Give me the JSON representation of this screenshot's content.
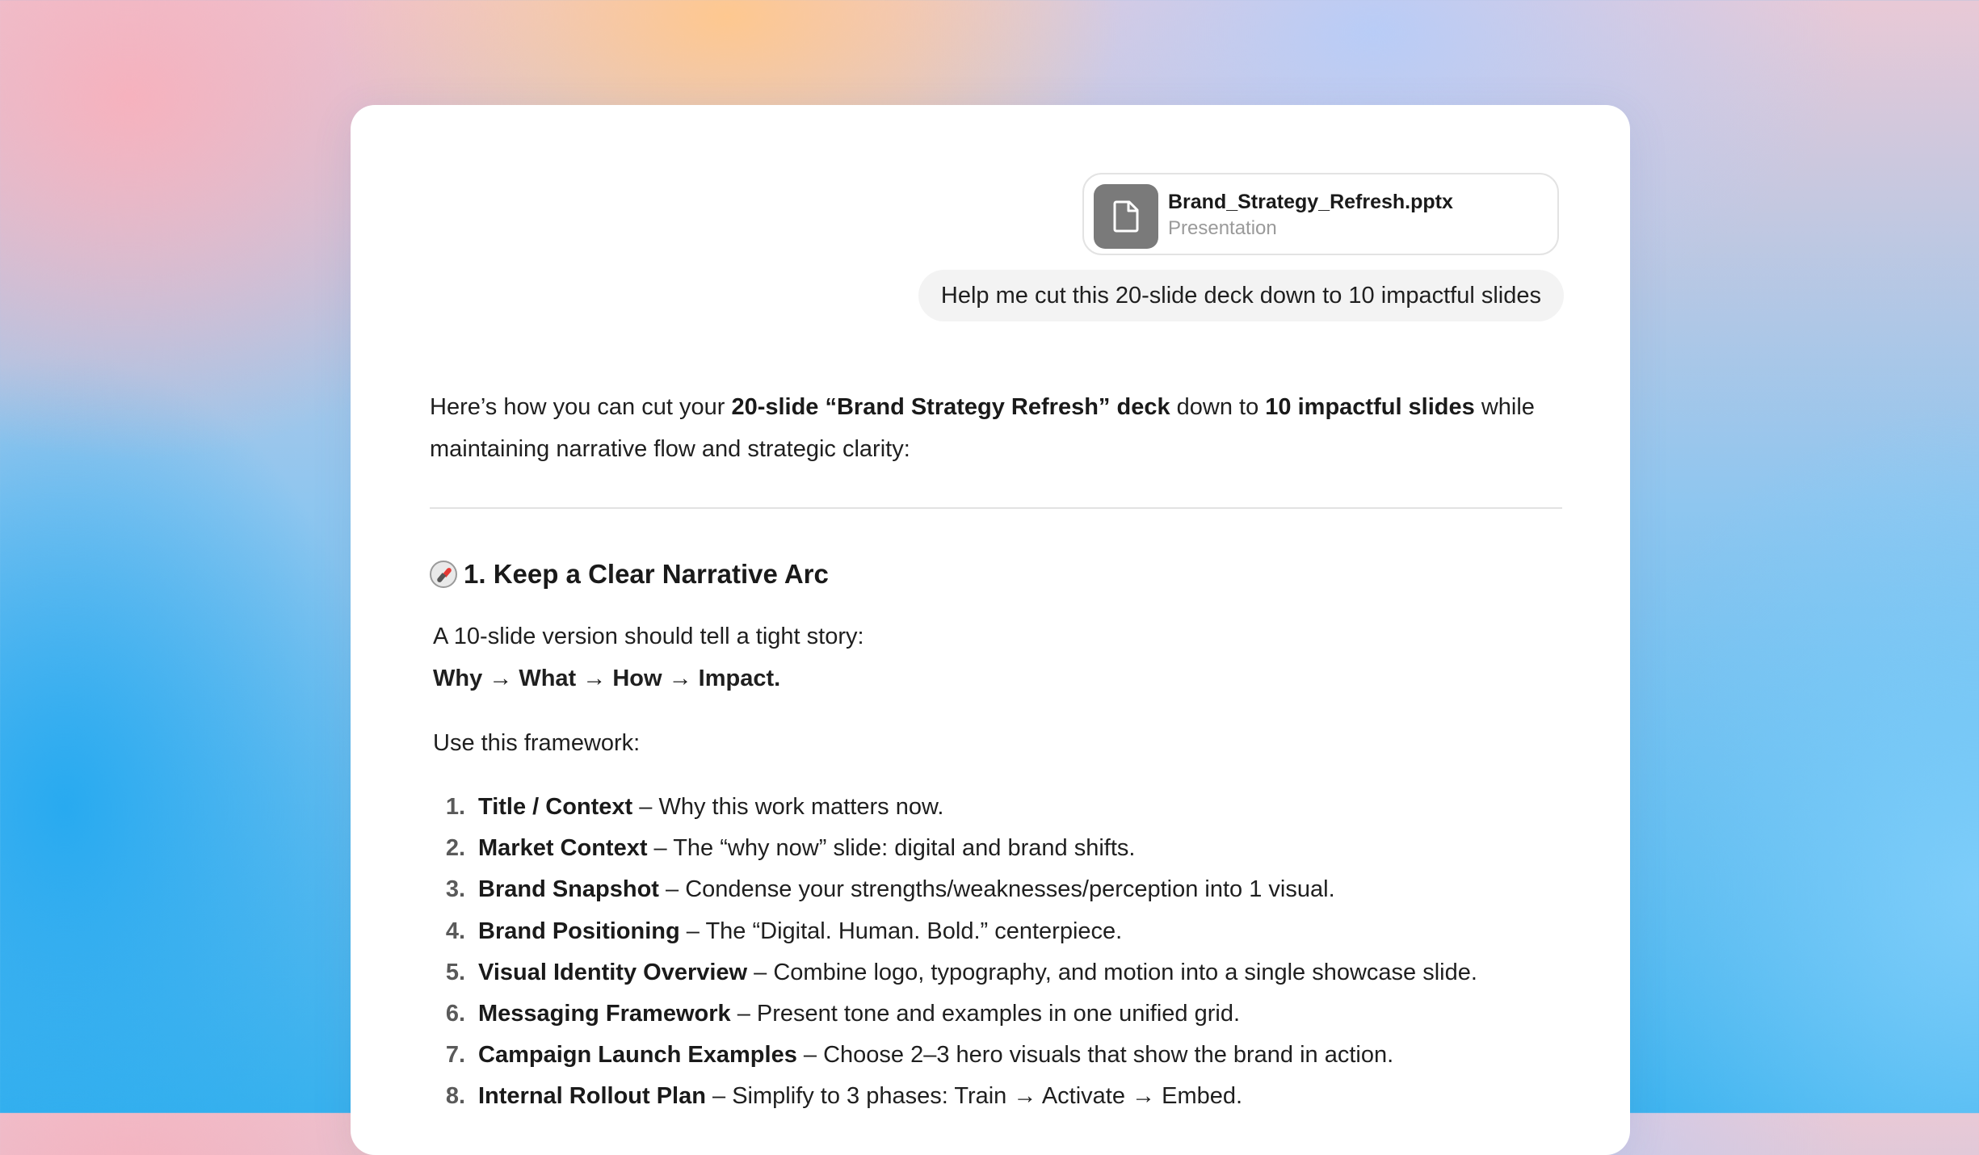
{
  "attachment": {
    "file_name": "Brand_Strategy_Refresh.pptx",
    "file_type": "Presentation",
    "icon": "document-icon"
  },
  "user_message": "Help me cut this 20-slide deck down to 10 impactful slides",
  "response": {
    "intro": {
      "t1": "Here’s how you can cut your ",
      "b1": "20-slide “Brand Strategy Refresh” deck",
      "t2": " down to ",
      "b2": "10 impactful slides",
      "t3": " while maintaining narrative flow and strategic clarity:"
    },
    "section": {
      "icon": "compass-icon",
      "title": "1. Keep a Clear Narrative Arc",
      "line1": "A 10-slide version should tell a tight story:",
      "line2": "Why → What → How → Impact.",
      "line3": "Use this framework:",
      "items": [
        {
          "num": "1.",
          "title": "Title / Context",
          "desc": " – Why this work matters now."
        },
        {
          "num": "2.",
          "title": "Market Context",
          "desc": " – The “why now” slide: digital and brand shifts."
        },
        {
          "num": "3.",
          "title": "Brand Snapshot",
          "desc": " – Condense your strengths/weaknesses/perception into 1 visual."
        },
        {
          "num": "4.",
          "title": "Brand Positioning",
          "desc": " – The “Digital. Human. Bold.” centerpiece."
        },
        {
          "num": "5.",
          "title": "Visual Identity Overview",
          "desc": " – Combine logo, typography, and motion into a single showcase slide."
        },
        {
          "num": "6.",
          "title": "Messaging Framework",
          "desc": " – Present tone and examples in one unified grid."
        },
        {
          "num": "7.",
          "title": "Campaign Launch Examples",
          "desc": " – Choose 2–3 hero visuals that show the brand in action."
        },
        {
          "num": "8.",
          "title": "Internal Rollout Plan",
          "desc": " – Simplify to 3 phases: Train → Activate → Embed."
        }
      ]
    }
  }
}
